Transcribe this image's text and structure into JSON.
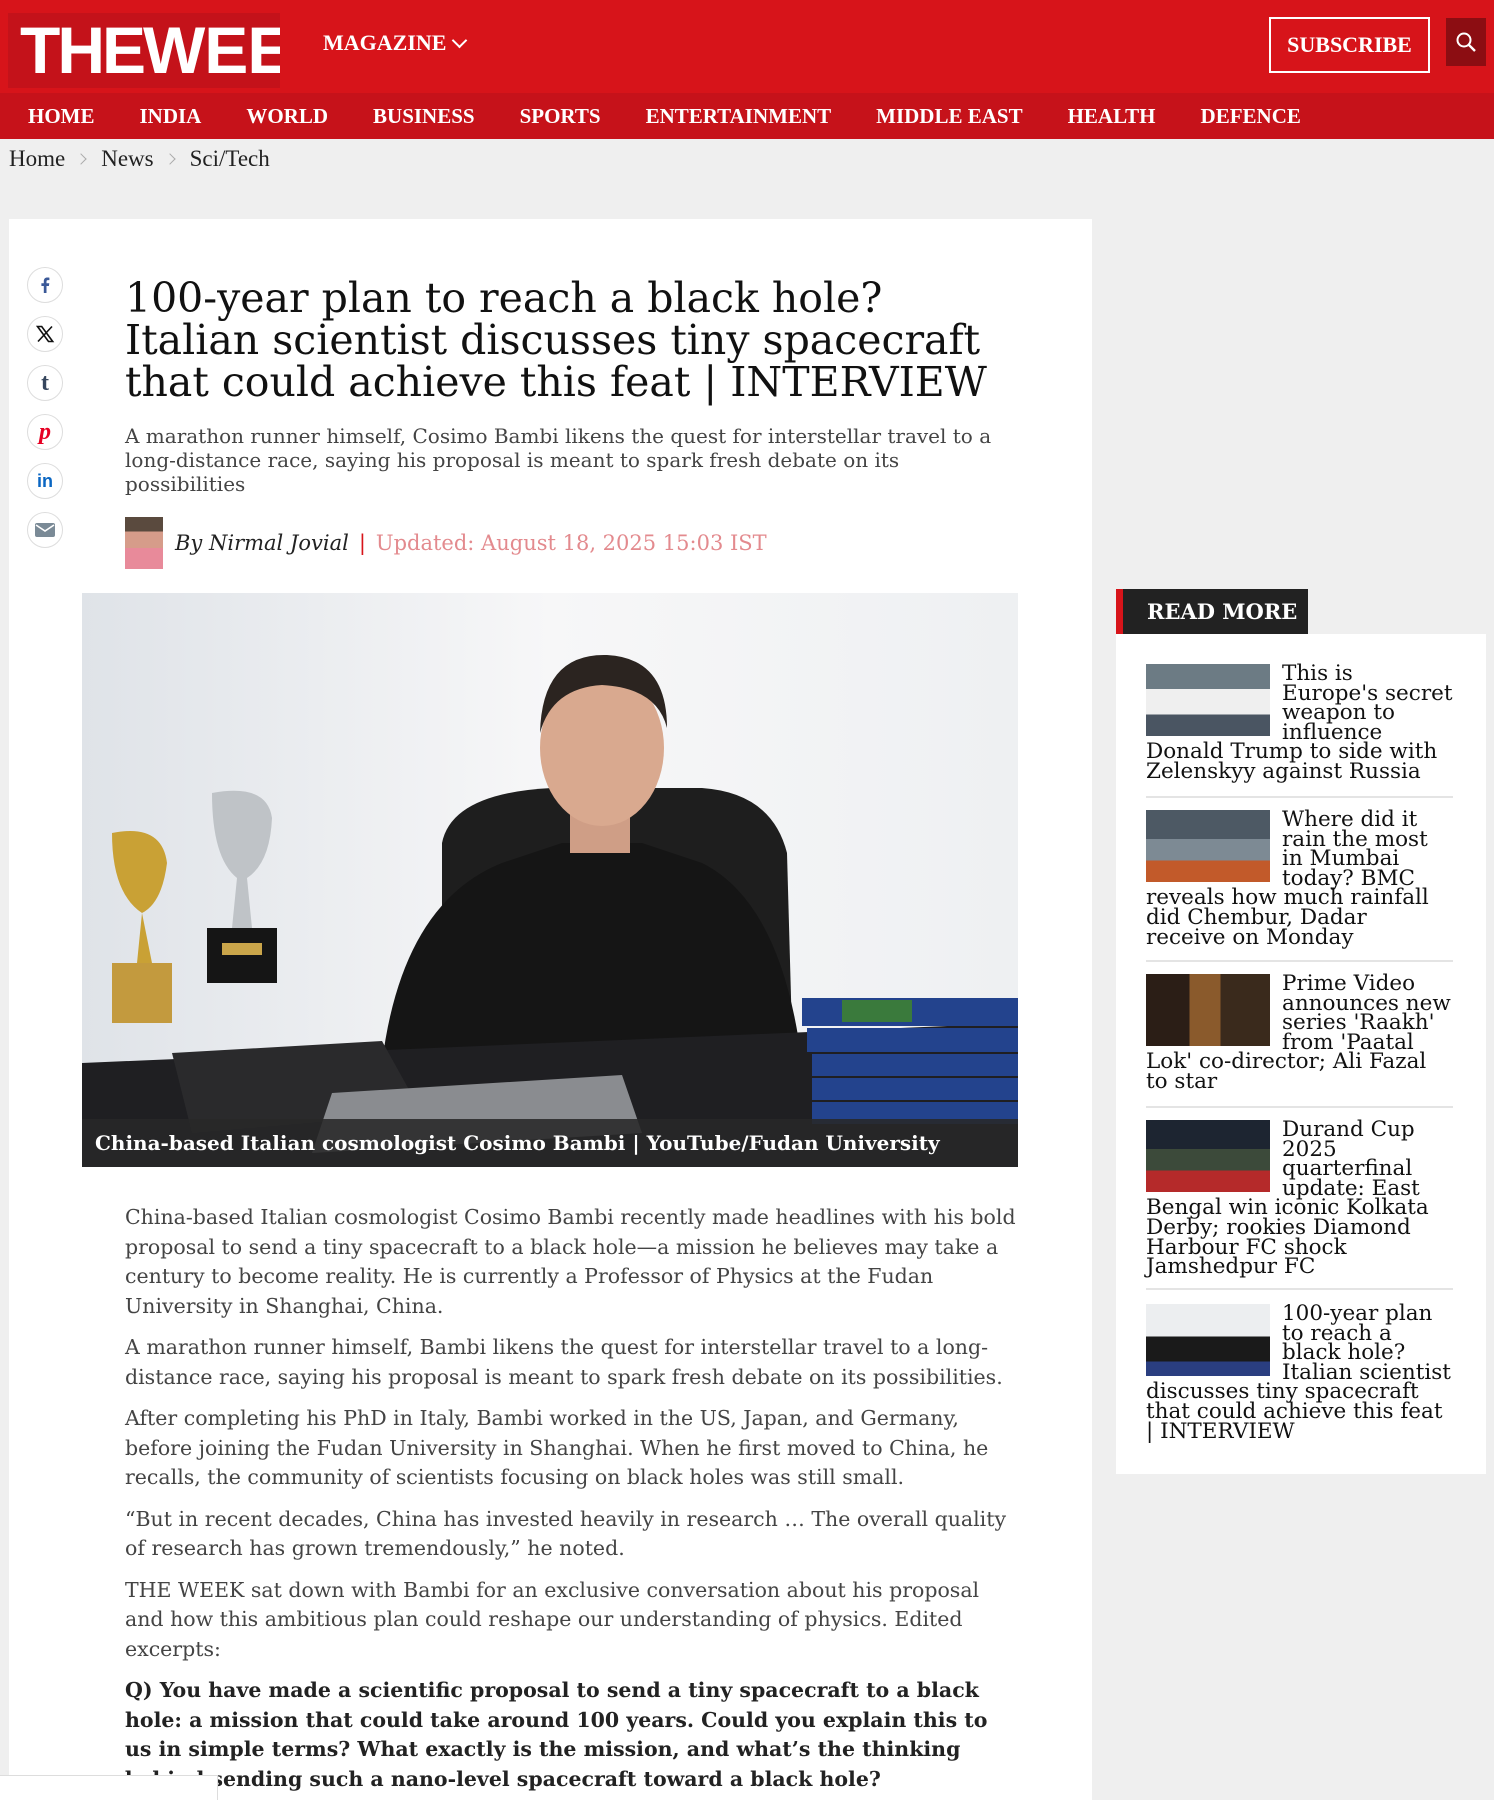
{
  "header": {
    "logo_the": "THE",
    "logo_week": "WEEK",
    "magazine_label": "MAGAZINE",
    "subscribe_label": "SUBSCRIBE"
  },
  "nav": {
    "items": [
      "HOME",
      "INDIA",
      "WORLD",
      "BUSINESS",
      "SPORTS",
      "ENTERTAINMENT",
      "MIDDLE EAST",
      "HEALTH",
      "DEFENCE"
    ]
  },
  "breadcrumb": [
    "Home",
    "News",
    "Sci/Tech"
  ],
  "article": {
    "headline": "100-year plan to reach a black hole? Italian scientist discusses tiny spacecraft that could achieve this feat | INTERVIEW",
    "standfirst": "A marathon runner himself, Cosimo Bambi likens the quest for interstellar travel to a long-distance race, saying his proposal is meant to spark fresh debate on its possibilities",
    "byline": "By Nirmal Jovial",
    "updated": "Updated: August 18, 2025 15:03 IST",
    "caption": "China-based Italian cosmologist Cosimo Bambi | YouTube/Fudan University",
    "paragraphs": [
      "China-based Italian cosmologist Cosimo Bambi recently made headlines with his bold proposal to send a tiny spacecraft to a black hole—a mission he believes may take a century to become reality. He is currently a Professor of Physics at the Fudan University in Shanghai, China.",
      "A marathon runner himself, Bambi likens the quest for interstellar travel to a long-distance race, saying his proposal is meant to spark fresh debate on its possibilities.",
      "After completing his PhD in Italy, Bambi worked in the US, Japan, and Germany, before joining the Fudan University in Shanghai. When he first moved to China, he recalls, the community of scientists focusing on black holes was still small.",
      "“But in recent decades, China has invested heavily in research … The overall quality of research has grown tremendously,” he noted.",
      "THE WEEK sat down with Bambi for an exclusive conversation about his proposal and how this ambitious plan could reshape our understanding of physics. Edited excerpts:"
    ],
    "question": "Q) You have made a scientific proposal to send a tiny spacecraft to a black hole: a mission that could take around 100 years. Could you explain this to us in simple terms? What exactly is the mission, and what’s the thinking behind sending such a nano-level spacecraft toward a black hole?"
  },
  "share_icons": [
    "facebook-icon",
    "x-icon",
    "tumblr-icon",
    "pinterest-icon",
    "linkedin-icon",
    "email-icon"
  ],
  "read_more": {
    "title": "READ MORE",
    "items": [
      {
        "title": "This is Europe's secret weapon to influence Donald Trump to side with Zelenskyy against Russia"
      },
      {
        "title": "Where did it rain the most in Mumbai today? BMC reveals how much rainfall did Chembur, Dadar receive on Monday"
      },
      {
        "title": "Prime Video announces new series 'Raakh' from 'Paatal Lok' co-director; Ali Fazal to star"
      },
      {
        "title": "Durand Cup 2025 quarterfinal update: East Bengal win iconic Kolkata Derby; rookies Diamond Harbour FC shock Jamshedpur FC"
      },
      {
        "title": "100-year plan to reach a black hole? Italian scientist discusses tiny spacecraft that could achieve this feat | INTERVIEW"
      }
    ]
  },
  "colors": {
    "brand_red": "#d7141a",
    "nav_red": "#c6121a",
    "dark": "#222222"
  }
}
